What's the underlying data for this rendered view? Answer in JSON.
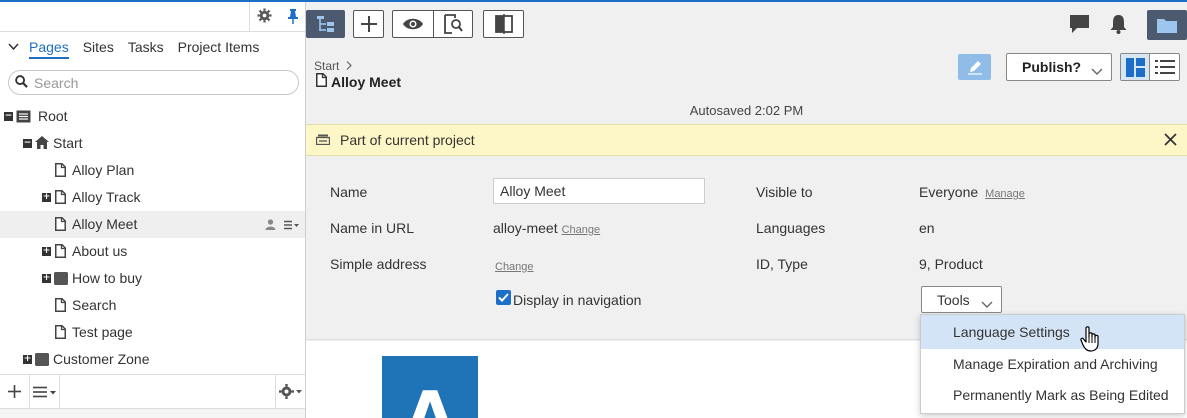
{
  "left_panel": {
    "tabs": [
      "Pages",
      "Sites",
      "Tasks",
      "Project Items"
    ],
    "search_placeholder": "Search",
    "tree": [
      {
        "label": "Root",
        "icon": "database-icon",
        "expander": "−"
      },
      {
        "label": "Start",
        "icon": "home-icon",
        "expander": "−"
      },
      {
        "label": "Alloy Plan",
        "icon": "page-icon",
        "expander": ""
      },
      {
        "label": "Alloy Track",
        "icon": "page-icon",
        "expander": "+"
      },
      {
        "label": "Alloy Meet",
        "icon": "page-icon",
        "expander": "",
        "selected": true
      },
      {
        "label": "About us",
        "icon": "page-icon",
        "expander": "+"
      },
      {
        "label": "How to buy",
        "icon": "folder-icon",
        "expander": "+"
      },
      {
        "label": "Search",
        "icon": "page-icon",
        "expander": ""
      },
      {
        "label": "Test page",
        "icon": "page-icon",
        "expander": ""
      },
      {
        "label": "Customer Zone",
        "icon": "folder-icon",
        "expander": "+"
      }
    ]
  },
  "page": {
    "breadcrumb": "Start",
    "title": "Alloy Meet",
    "autosaved": "Autosaved 2:02 PM",
    "publish_label": "Publish?"
  },
  "notice": {
    "text": "Part of current project"
  },
  "properties": {
    "name_label": "Name",
    "name_value": "Alloy Meet",
    "url_label": "Name in URL",
    "url_value": "alloy-meet",
    "url_change": "Change",
    "simple_label": "Simple address",
    "simple_change": "Change",
    "display_nav_label": "Display in navigation",
    "visible_label": "Visible to",
    "visible_value": "Everyone",
    "visible_manage": "Manage",
    "languages_label": "Languages",
    "languages_value": "en",
    "id_type_label": "ID, Type",
    "id_type_value": "9, Product",
    "tools_label": "Tools"
  },
  "tools_menu": {
    "items": [
      "Language Settings",
      "Manage Expiration and Archiving",
      "Permanently Mark as Being Edited"
    ]
  },
  "preview": {
    "logo_letter": "A"
  },
  "colors": {
    "accent": "#1d6ec7",
    "notice_bg": "#fdf6c6",
    "toolbar_active": "#4b5a6e"
  }
}
